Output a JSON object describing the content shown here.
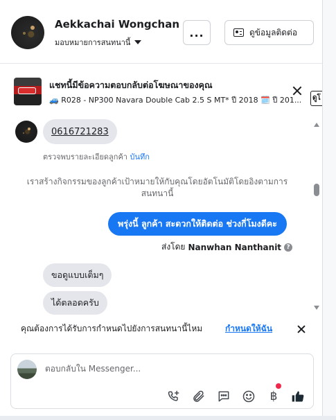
{
  "header": {
    "name": "Aekkachai Wongchan",
    "assign_label": "มอบหมายการสนทนานี้",
    "more_label": "...",
    "contact_label": "ดูข้อมูลติดต่อ"
  },
  "ad": {
    "title": "แชทนี้มีข้อความตอบกลับต่อโฆษณาของคุณ",
    "subtitle": "🚙 R028 - NP300 Navara Double Cab 2.5 S MT* ปี 2018 🗓️ ปี 201...",
    "side_text": "ดูโ"
  },
  "thread": {
    "phone_message": "0616721283",
    "check_detail_text": "ตรวจพบรายละเอียดลูกค้า",
    "check_detail_link": "บันทึก",
    "system_note": "เราสร้างกิจกรรมของลูกค้าเป้าหมายให้กับคุณโดยอัตโนมัติโดยอิงตามการสนทนานี้",
    "outgoing_message": "พรุ่งนี้ ลูกค้า สะดวกให้ติดต่อ ช่วงกี่โมงดีคะ",
    "sent_by_prefix": "ส่งโดย",
    "sent_by_name": "Nanwhan Nanthanit",
    "incoming_1": "ขอดูแบบเต็มๆ",
    "incoming_2": "ได้ตลอดครับ"
  },
  "reminder": {
    "text": "คุณต้องการได้รับการกำหนดไปยังการสนทนานี้ไหม",
    "link": "กำหนดให้ฉัน"
  },
  "composer": {
    "placeholder": "ตอบกลับใน Messenger...",
    "baht_symbol": "฿"
  },
  "colors": {
    "accent": "#1877f2",
    "bubble_incoming": "#e4e6eb",
    "badge": "#f02849"
  },
  "icons": [
    "more-icon",
    "contact-card-icon",
    "close-icon",
    "phone-plus-icon",
    "attachment-icon",
    "saved-reply-icon",
    "emoji-icon",
    "baht-icon",
    "thumbs-up-icon",
    "help-icon"
  ]
}
